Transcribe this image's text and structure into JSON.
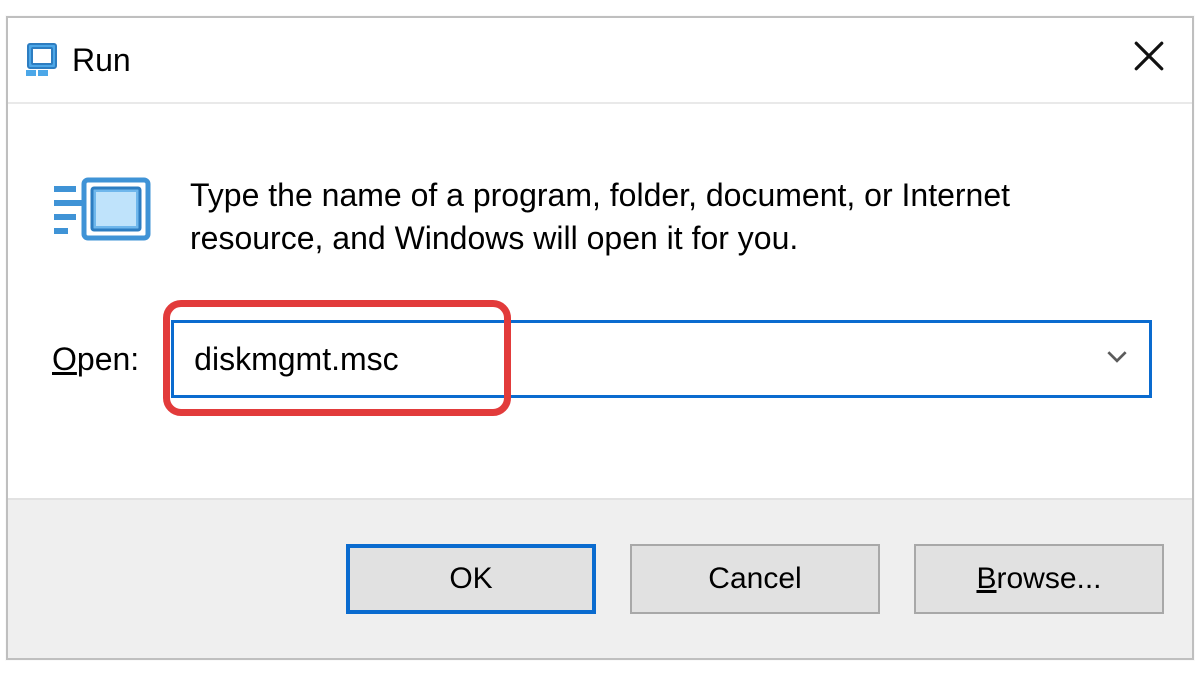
{
  "titlebar": {
    "title": "Run"
  },
  "body": {
    "instruction": "Type the name of a program, folder, document, or Internet resource, and Windows will open it for you.",
    "open_label_accel": "O",
    "open_label_rest": "pen:",
    "input_value": "diskmgmt.msc"
  },
  "footer": {
    "ok_label": "OK",
    "cancel_label": "Cancel",
    "browse_accel": "B",
    "browse_rest": "rowse..."
  },
  "colors": {
    "accent": "#0a6bcf",
    "highlight": "#e23b3b",
    "footer_bg": "#efefef",
    "button_bg": "#e1e1e1"
  }
}
